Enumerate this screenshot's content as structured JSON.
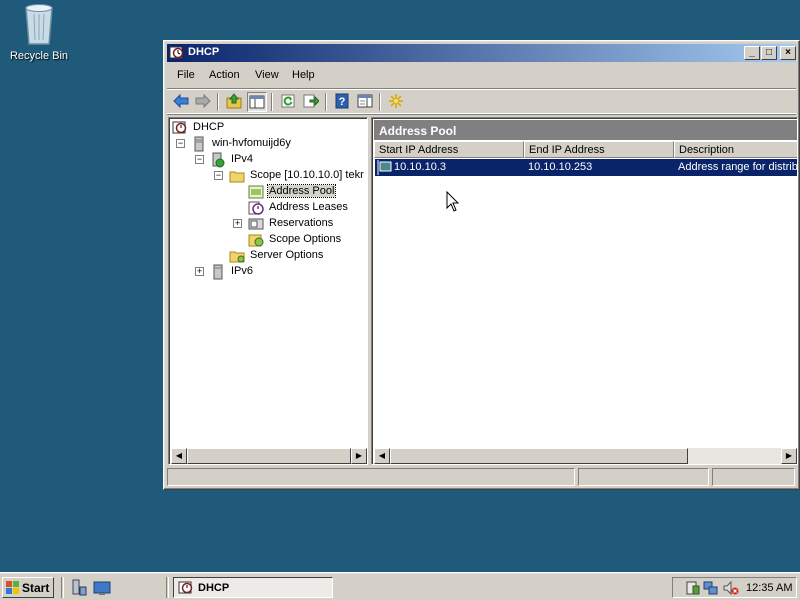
{
  "desktop": {
    "recycle_bin_label": "Recycle Bin"
  },
  "window": {
    "title": "DHCP",
    "controls": {
      "minimize": "_",
      "maximize": "□",
      "close": "×"
    }
  },
  "menu": [
    "File",
    "Action",
    "View",
    "Help"
  ],
  "toolbar": {
    "icons": [
      "back-icon",
      "forward-icon",
      "up-folder-icon",
      "show-hide-tree-icon",
      "refresh-icon",
      "export-list-icon",
      "help-icon",
      "properties-view-icon",
      "star-burst-icon"
    ]
  },
  "tree": {
    "root": "DHCP",
    "server": "win-hvfomuijd6y",
    "ipv4": "IPv4",
    "scope": "Scope [10.10.10.0] tekr",
    "address_pool": "Address Pool",
    "address_leases": "Address Leases",
    "reservations": "Reservations",
    "scope_options": "Scope Options",
    "server_options": "Server Options",
    "ipv6": "IPv6",
    "expanders": {
      "collapse": "−",
      "expand": "+"
    }
  },
  "details": {
    "header": "Address Pool",
    "columns": [
      "Start IP Address",
      "End IP Address",
      "Description"
    ],
    "rows": [
      {
        "start_ip": "10.10.10.3",
        "end_ip": "10.10.10.253",
        "description": "Address range for distrib"
      }
    ]
  },
  "scroll_arrows": {
    "left": "◀",
    "right": "▶"
  },
  "taskbar": {
    "start_label": "Start",
    "task_label": "DHCP",
    "clock": "12:35 AM"
  },
  "colors": {
    "desktop": "#1f5a7a",
    "titlebar_start": "#0a246a",
    "titlebar_end": "#a6caf0",
    "selection": "#0a246a",
    "pane_header": "#808080"
  }
}
